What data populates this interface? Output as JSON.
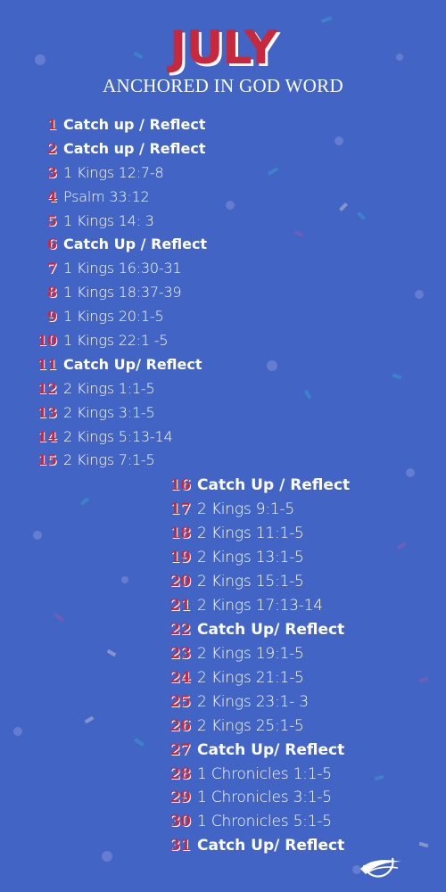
{
  "title": "JULY",
  "subtitle": "ANCHORED IN GOD WORD",
  "colors": {
    "background": "#4264c4",
    "accent": "#c8283c",
    "text": "#ffffff"
  },
  "logo_icon": "wave-circle-logo",
  "days": [
    {
      "day": "1",
      "reading": "Catch up / Reflect",
      "bold": true
    },
    {
      "day": "2",
      "reading": "Catch up / Reflect",
      "bold": true
    },
    {
      "day": "3",
      "reading": "1 Kings 12:7-8",
      "bold": false
    },
    {
      "day": "4",
      "reading": "Psalm 33:12",
      "bold": false
    },
    {
      "day": "5",
      "reading": "1 Kings 14: 3",
      "bold": false
    },
    {
      "day": "6",
      "reading": "Catch Up / Reflect",
      "bold": true
    },
    {
      "day": "7",
      "reading": "1 Kings 16:30-31",
      "bold": false
    },
    {
      "day": "8",
      "reading": "1 Kings 18:37-39",
      "bold": false
    },
    {
      "day": "9",
      "reading": "1 Kings 20:1-5",
      "bold": false
    },
    {
      "day": "10",
      "reading": "1 Kings 22:1 -5",
      "bold": false
    },
    {
      "day": "11",
      "reading": "Catch Up/ Reflect",
      "bold": true
    },
    {
      "day": "12",
      "reading": "2 Kings 1:1-5",
      "bold": false
    },
    {
      "day": "13",
      "reading": "2 Kings 3:1-5",
      "bold": false
    },
    {
      "day": "14",
      "reading": "2 Kings 5:13-14",
      "bold": false
    },
    {
      "day": "15",
      "reading": "2 Kings 7:1-5",
      "bold": false
    },
    {
      "day": "16",
      "reading": "Catch Up / Reflect",
      "bold": true
    },
    {
      "day": "17",
      "reading": "2 Kings 9:1-5",
      "bold": false
    },
    {
      "day": "18",
      "reading": "2 Kings 11:1-5",
      "bold": false
    },
    {
      "day": "19",
      "reading": "2 Kings 13:1-5",
      "bold": false
    },
    {
      "day": "20",
      "reading": "2 Kings 15:1-5",
      "bold": false
    },
    {
      "day": "21",
      "reading": "2 Kings 17:13-14",
      "bold": false
    },
    {
      "day": "22",
      "reading": "Catch Up/ Reflect",
      "bold": true
    },
    {
      "day": "23",
      "reading": "2 Kings 19:1-5",
      "bold": false
    },
    {
      "day": "24",
      "reading": "2 Kings 21:1-5",
      "bold": false
    },
    {
      "day": "25",
      "reading": "2 Kings 23:1- 3",
      "bold": false
    },
    {
      "day": "26",
      "reading": "2 Kings 25:1-5",
      "bold": false
    },
    {
      "day": "27",
      "reading": "Catch Up/ Reflect",
      "bold": true
    },
    {
      "day": "28",
      "reading": "1 Chronicles 1:1-5",
      "bold": false
    },
    {
      "day": "29",
      "reading": "1 Chronicles 3:1-5",
      "bold": false
    },
    {
      "day": "30",
      "reading": "1 Chronicles 5:1-5",
      "bold": false
    },
    {
      "day": "31",
      "reading": "Catch Up/ Reflect",
      "bold": true
    }
  ]
}
